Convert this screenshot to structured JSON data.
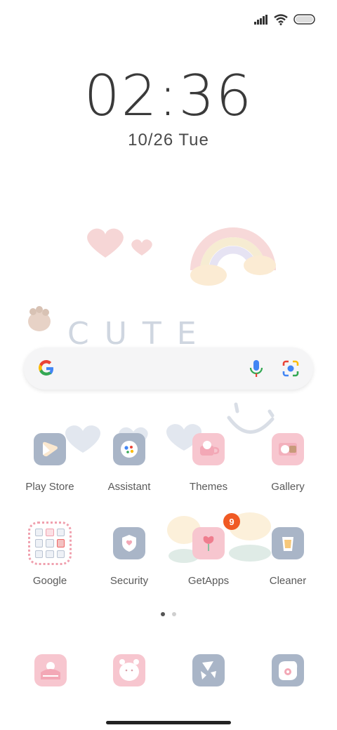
{
  "status": {
    "icons": [
      "signal-icon",
      "wifi-icon",
      "battery-icon"
    ]
  },
  "clock": {
    "time": "02:36",
    "date": "10/26",
    "weekday": "Tue"
  },
  "decoration": {
    "cute_text": "CUTE"
  },
  "search": {
    "icons": [
      "google-g-icon",
      "mic-icon",
      "lens-icon"
    ]
  },
  "apps_row1": [
    {
      "label": "Play Store"
    },
    {
      "label": "Assistant"
    },
    {
      "label": "Themes"
    },
    {
      "label": "Gallery"
    }
  ],
  "apps_row2": [
    {
      "label": "Google"
    },
    {
      "label": "Security"
    },
    {
      "label": "GetApps",
      "badge": "9"
    },
    {
      "label": "Cleaner"
    }
  ],
  "pages": {
    "count": 2,
    "active": 1
  },
  "dock": [
    "phone-icon",
    "messages-icon",
    "camera-icon",
    "browser-icon"
  ],
  "colors": {
    "icon_blue": "#a9b5c7",
    "icon_pink": "#f7c6cf",
    "badge": "#f05a24"
  }
}
